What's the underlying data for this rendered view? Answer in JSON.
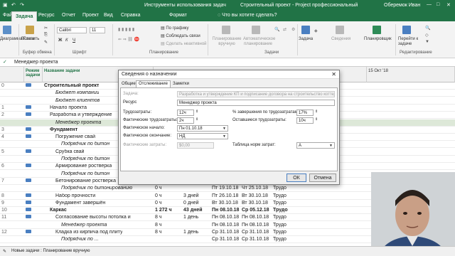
{
  "titlebar": {
    "context_tools": "Инструменты использования задач",
    "document": "Строительный проект - Project профессиональный",
    "user": "Оберемок Иван"
  },
  "tabs": [
    "Файл",
    "Задача",
    "Ресурс",
    "Отчет",
    "Проект",
    "Вид",
    "Справка",
    "Формат"
  ],
  "active_tab": "Задача",
  "search_placeholder": "Что вы хотите сделать?",
  "ribbon": {
    "gantt_label": "Диаграмма Ганта",
    "paste_label": "Вставить",
    "font_name": "Calibri",
    "font_size": "11",
    "font_bold": "Ж",
    "font_italic": "К",
    "font_underline": "Ч",
    "schedule_by": "По графику",
    "respect_links": "Соблюдать связи",
    "inactivate": "Сделать неактивной",
    "manual": "Планирование вручную",
    "auto": "Автоматическое планирование",
    "task": "Задача",
    "info": "Сведения",
    "planner": "Планировщик",
    "goto": "Перейти к задаче",
    "groups": {
      "clipboard": "Буфер обмена",
      "font": "Шрифт",
      "schedule": "Планирование",
      "tasks": "Задачи",
      "edit": "Редактирование"
    }
  },
  "formula_value": "Менеджер проекта",
  "grid": {
    "headers": {
      "mode": "Режим задачи",
      "name": "Название задачи"
    },
    "timescale": "15 Окт '18",
    "rows": [
      {
        "n": "0",
        "name": "Строительный проект",
        "bold": true,
        "indent": 0
      },
      {
        "n": "",
        "name": "Бюджет компании",
        "italic": true,
        "indent": 2
      },
      {
        "n": "",
        "name": "Бюджет клиентов",
        "italic": true,
        "indent": 2
      },
      {
        "n": "1",
        "name": "Начало проекта",
        "indent": 1
      },
      {
        "n": "2",
        "name": "Разработка и утверждение",
        "indent": 1
      },
      {
        "n": "",
        "name": "Менеджер проекта",
        "italic": true,
        "indent": 2,
        "selected": true
      },
      {
        "n": "3",
        "name": "Фундамент",
        "bold": true,
        "indent": 1
      },
      {
        "n": "4",
        "name": "Погружение свай",
        "indent": 2
      },
      {
        "n": "",
        "name": "Подрядчик по битон",
        "italic": true,
        "indent": 3
      },
      {
        "n": "5",
        "name": "Срубка свай",
        "indent": 2
      },
      {
        "n": "",
        "name": "Подрядчик по битон",
        "italic": true,
        "indent": 3
      },
      {
        "n": "6",
        "name": "Армирование ростверка",
        "indent": 2
      },
      {
        "n": "",
        "name": "Подрядчик по битон",
        "italic": true,
        "indent": 3
      },
      {
        "n": "7",
        "name": "Бетонирование ростверка",
        "indent": 2
      },
      {
        "n": "",
        "name": "Подрядчик по битонированию",
        "italic": true,
        "indent": 3,
        "work": "0 ч",
        "dur": "",
        "start": "Пт 19.10.18",
        "finish": "Чт 25.10.18",
        "detail": "Трудо"
      },
      {
        "n": "8",
        "name": "Набор прочности",
        "indent": 2,
        "work": "0 ч",
        "dur": "3 дней",
        "start": "Пт 26.10.18",
        "finish": "Вт 30.10.18",
        "detail": "Трудо"
      },
      {
        "n": "9",
        "name": "Фундамент завершён",
        "indent": 2,
        "work": "0 ч",
        "dur": "0 дней",
        "start": "Вт 30.10.18",
        "finish": "Вт 30.10.18",
        "detail": "Трудо"
      },
      {
        "n": "10",
        "name": "Каркас",
        "bold": true,
        "indent": 1,
        "work": "1 272 ч",
        "dur": "43 дней",
        "start": "Пн 08.10.18",
        "finish": "Ср 05.12.18",
        "detail": "Трудо"
      },
      {
        "n": "11",
        "name": "Согласование высоты потолка и",
        "indent": 2,
        "work": "8 ч",
        "dur": "1 день",
        "start": "Пн 08.10.18",
        "finish": "Пн 08.10.18",
        "detail": "Трудо"
      },
      {
        "n": "",
        "name": "Менеджер проекта",
        "italic": true,
        "indent": 3,
        "work": "8 ч",
        "dur": "",
        "start": "Пн 08.10.18",
        "finish": "Пн 08.10.18",
        "detail": "Трудо"
      },
      {
        "n": "12",
        "name": "Кладка из кирпича под плиту",
        "indent": 2,
        "work": "8 ч",
        "dur": "1 день",
        "start": "Ср 31.10.18",
        "finish": "Ср 31.10.18",
        "detail": "Трудо"
      },
      {
        "n": "",
        "name": "Подрядчик по ...",
        "italic": true,
        "indent": 3,
        "work": "",
        "dur": "",
        "start": "Ср 31.10.18",
        "finish": "Ср 31.10.18",
        "detail": "Трудо"
      }
    ]
  },
  "dialog": {
    "title": "Сведения о назначении",
    "tabs": [
      "Общие",
      "Отслеживание",
      "Заметки"
    ],
    "active_tab": "Отслеживание",
    "task_label": "Задача:",
    "task_value": "Разработка и утверждение КП и подписание договора на строительство коттеджа",
    "resource_label": "Ресурс",
    "resource_value": "Менеджер проекта",
    "work_label": "Трудозатраты:",
    "work_value": "12ч",
    "actual_work_label": "Фактические трудозатраты:",
    "actual_work_value": "2ч",
    "actual_start_label": "Фактическое начало:",
    "actual_start_value": "Пн 01.10.18",
    "actual_finish_label": "Фактическое окончание:",
    "actual_finish_value": "НД",
    "actual_cost_label": "Фактические затраты:",
    "actual_cost_value": "$0,00",
    "pct_label": "% завершения по трудозатратам:",
    "pct_value": "17%",
    "remaining_label": "Оставшиеся трудозатраты:",
    "remaining_value": "10ч",
    "cost_table_label": "Таблица норм затрат:",
    "cost_table_value": "A",
    "ok": "ОК",
    "cancel": "Отмена"
  },
  "status": {
    "new_tasks": "Новые задачи : Планирование вручную"
  }
}
